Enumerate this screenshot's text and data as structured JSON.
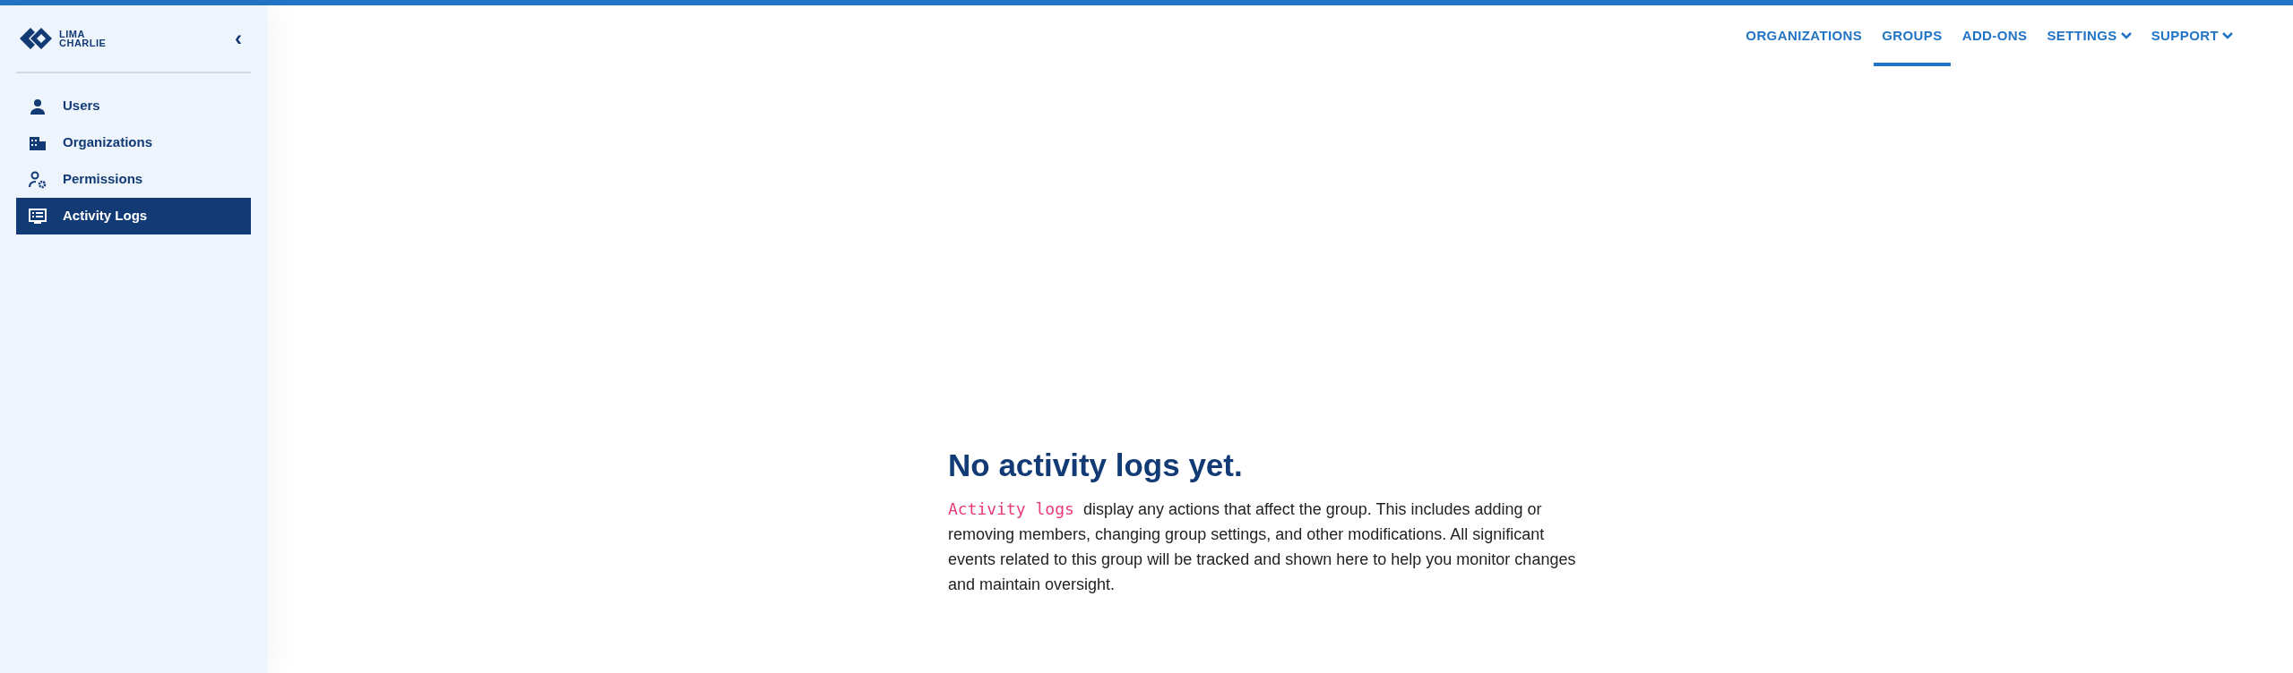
{
  "sidebar": {
    "logo": {
      "line_1": "LIMA",
      "line_2": "CHARLIE"
    },
    "collapse_icon": "‹",
    "items": [
      {
        "label": "Users",
        "kind": "user",
        "selected": false
      },
      {
        "label": "Organizations",
        "kind": "building",
        "selected": false
      },
      {
        "label": "Permissions",
        "kind": "user-gear",
        "selected": false
      },
      {
        "label": "Activity Logs",
        "kind": "monitor",
        "selected": true
      }
    ]
  },
  "top_nav": [
    {
      "label": "ORGANIZATIONS",
      "dropdown": false,
      "selected": false
    },
    {
      "label": "GROUPS",
      "dropdown": false,
      "selected": true
    },
    {
      "label": "ADD-ONS",
      "dropdown": false,
      "selected": false
    },
    {
      "label": "SETTINGS",
      "dropdown": true,
      "selected": false
    },
    {
      "label": "SUPPORT",
      "dropdown": true,
      "selected": false
    }
  ],
  "empty_state": {
    "title": "No activity logs yet.",
    "code_term": "Activity logs",
    "description": "display any actions that affect the group. This includes adding or removing members, changing group settings, and other modifications. All significant events related to this group will be tracked and shown here to help you monitor changes and maintain oversight."
  }
}
